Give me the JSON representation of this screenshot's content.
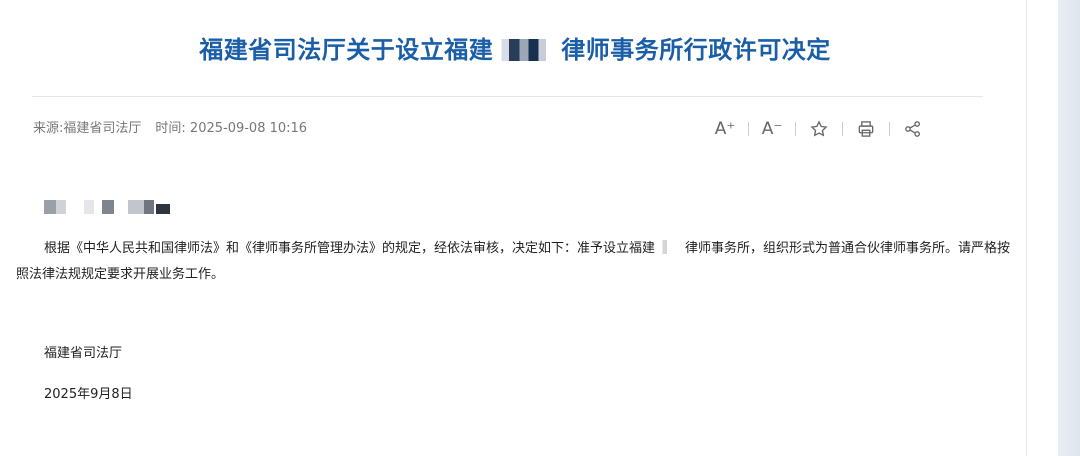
{
  "article": {
    "title_before": "福建省司法厅关于设立福建",
    "title_after": "律师事务所行政许可决定",
    "source_label": "来源:福建省司法厅",
    "time_label": "时间:",
    "time_value": "2025-09-08 10:16"
  },
  "toolbar": {
    "font_larger_label": "A⁺",
    "font_smaller_label": "A⁻"
  },
  "body": {
    "paragraph_part1": "根据《中华人民共和国律师法》和《律师事务所管理办法》的规定，经依法审核，决定如下：准予设立福建",
    "paragraph_part2": "律师事务所，组织形式为普通合伙律师事务所。请严格按照法律法规规定要求开展业务工作。",
    "signature": "福建省司法厅",
    "date": "2025年9月8日"
  },
  "icons": {
    "star": "star-icon",
    "print": "print-icon",
    "share": "share-icon"
  },
  "colors": {
    "title": "#1a5ea8",
    "text": "#222222",
    "meta": "#777777"
  }
}
